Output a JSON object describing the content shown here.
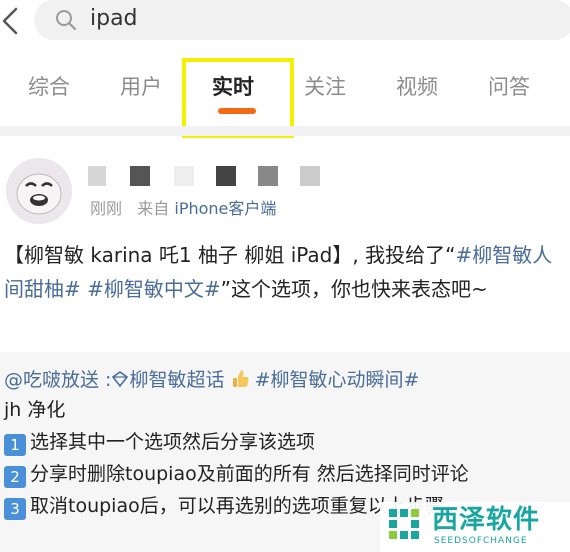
{
  "search": {
    "query": "ipad"
  },
  "tabs": [
    {
      "label": "综合",
      "active": false
    },
    {
      "label": "用户",
      "active": false
    },
    {
      "label": "实时",
      "active": true
    },
    {
      "label": "关注",
      "active": false
    },
    {
      "label": "视频",
      "active": false
    },
    {
      "label": "问答",
      "active": false
    }
  ],
  "post": {
    "time": "刚刚",
    "source_prefix": "来自",
    "source": "iPhone客户端",
    "text_part1": "【柳智敏 karina 吒1 柚子 柳姐 iPad】, 我投给了“",
    "tag1": "#柳智敏人间甜柚#",
    "tag2": "#柳智敏中文#",
    "text_part2": "”这个选项，你也快来表态吧~"
  },
  "quote": {
    "mention": "@吃啵放送 :",
    "topic": "柳智敏超话",
    "hashtag": "#柳智敏心动瞬间#",
    "line2": "jh 净化",
    "steps": [
      {
        "num": "1",
        "text": "选择其中一个选项然后分享该选项"
      },
      {
        "num": "2",
        "text": "分享时删除toupiao及前面的所有 然后选择同时评论"
      },
      {
        "num": "3",
        "text": "取消toupiao后，可以再选别的选项重复以上步骤"
      }
    ]
  },
  "watermark": {
    "title": "西泽软件",
    "subtitle": "SEEDSOFCHANGE"
  },
  "colors": {
    "accent": "#f26a12",
    "link": "#4a6c9b",
    "highlight": "#f5f000",
    "brand": "#1aa6a0"
  }
}
